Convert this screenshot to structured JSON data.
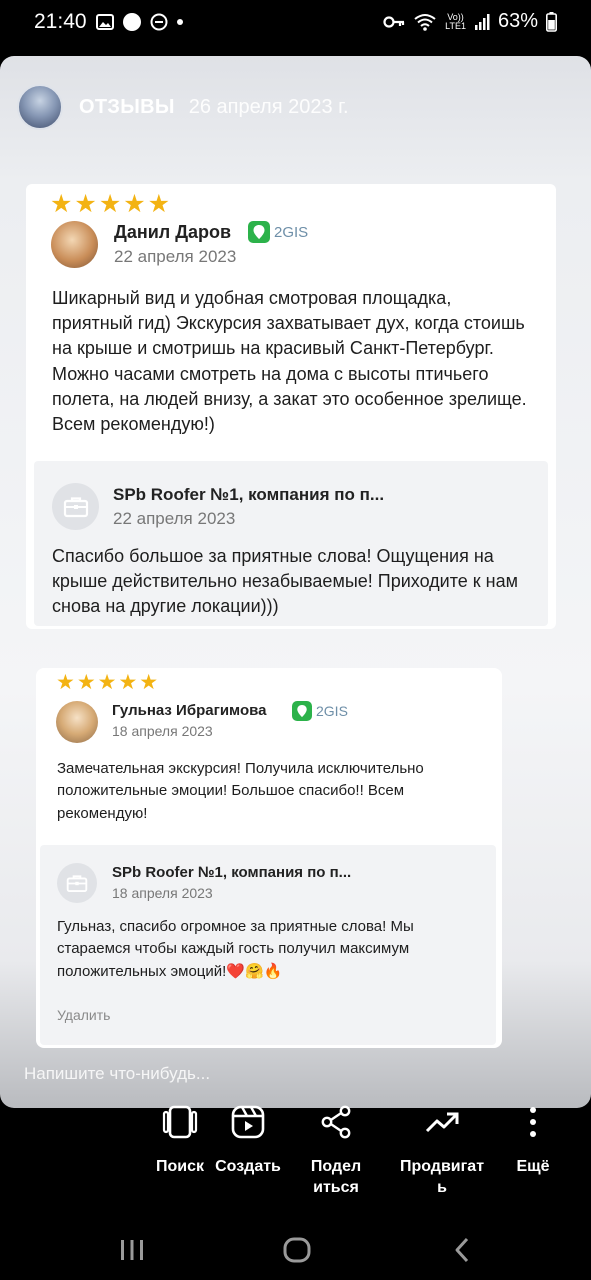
{
  "status_bar": {
    "time": "21:40",
    "volte": "Vo))",
    "lte": "LTE1",
    "battery": "63%"
  },
  "story": {
    "title": "ОТЗЫВЫ",
    "date": "26 апреля 2023 г.",
    "message_placeholder": "Напишите что-нибудь..."
  },
  "reviews": [
    {
      "stars": "★★★★★",
      "author": "Данил Даров",
      "source": "2GIS",
      "date": "22 апреля 2023",
      "text": "Шикарный вид и удобная смотровая площадка, приятный гид) Экскурсия захватывает дух, когда стоишь на крыше и смотришь на красивый Санкт-Петербург. Можно часами смотреть на дома с высоты птичьего полета, на людей внизу, а закат это особенное зрелище. Всем рекомендую!)",
      "reply": {
        "company": "SPb Roofer №1, компания по п...",
        "date": "22 апреля 2023",
        "text": "Спасибо большое за приятные слова! Ощущения на крыше действительно незабываемые! Приходите к нам снова на другие локации)))"
      }
    },
    {
      "stars": "★★★★★",
      "author": "Гульназ Ибрагимова",
      "source": "2GIS",
      "date": "18 апреля 2023",
      "text": "Замечательная экскурсия! Получила исключительно положительные эмоции! Большое спасибо!! Всем рекомендую!",
      "reply": {
        "company": "SPb Roofer №1, компания по п...",
        "date": "18 апреля 2023",
        "text": "Гульназ, спасибо огромное за приятные слова! Мы стараемся чтобы каждый гость получил максимум положительных эмоций!❤️🤗🔥",
        "delete_label": "Удалить"
      }
    }
  ],
  "actions": [
    {
      "label": "Поиск",
      "icon": "device-search-icon"
    },
    {
      "label": "Создать",
      "icon": "reels-create-icon"
    },
    {
      "label": "Подел\nиться",
      "icon": "share-icon"
    },
    {
      "label": "Продвигат\nь",
      "icon": "trending-up-icon"
    },
    {
      "label": "Ещё",
      "icon": "more-vertical-icon"
    }
  ],
  "colors": {
    "star": "#f3b313",
    "gis_green": "#2cb24a",
    "gis_text": "#6e8fa8"
  }
}
